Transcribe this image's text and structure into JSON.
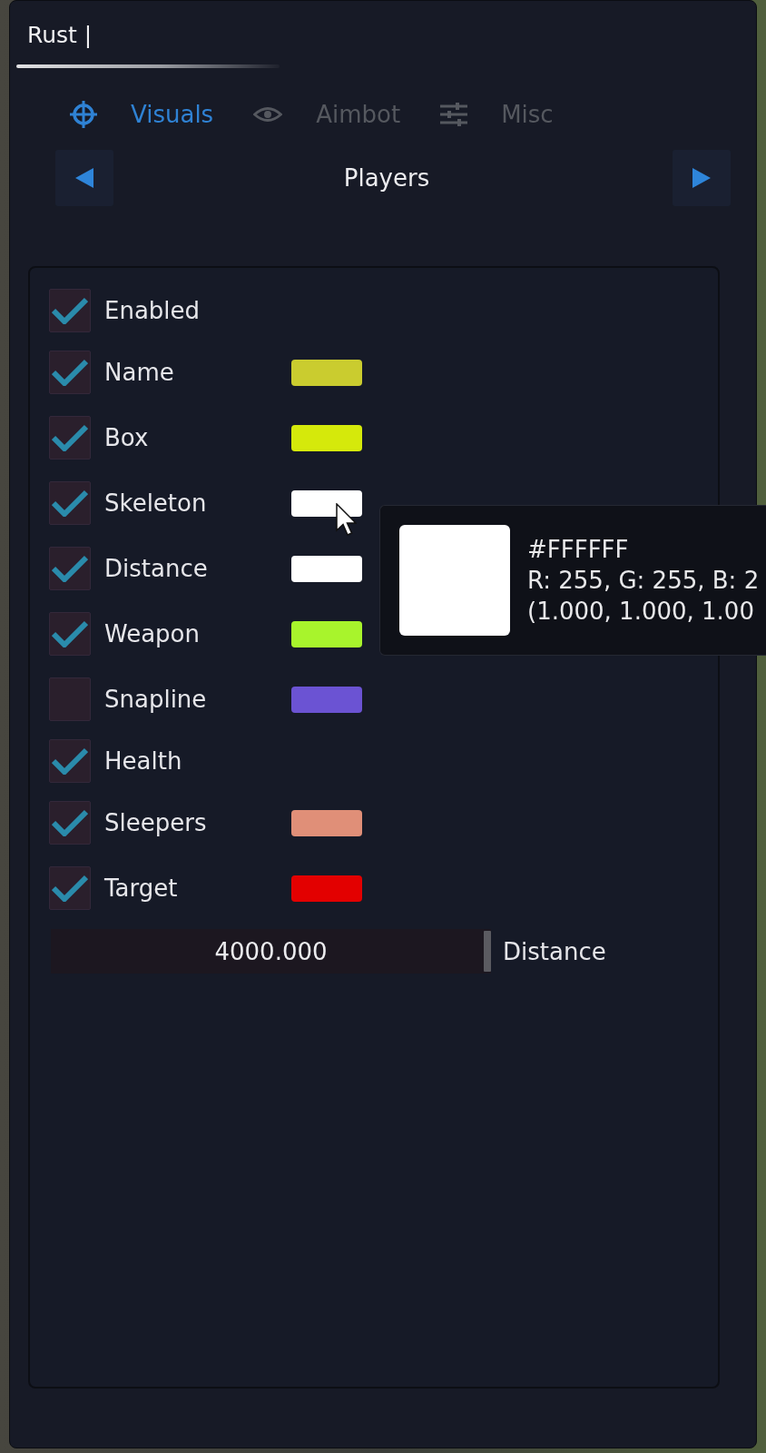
{
  "window": {
    "title": "Rust |"
  },
  "tabs": [
    {
      "label": "Visuals",
      "selected": true
    },
    {
      "label": "Aimbot",
      "selected": false
    },
    {
      "label": "Misc",
      "selected": false
    }
  ],
  "category_nav": {
    "label": "Players"
  },
  "options": [
    {
      "label": "Enabled",
      "checked": true
    },
    {
      "label": "Name",
      "checked": true,
      "color": "#cacc2f"
    },
    {
      "label": "Box",
      "checked": true,
      "color": "#d5e90b"
    },
    {
      "label": "Skeleton",
      "checked": true,
      "color": "#ffffff"
    },
    {
      "label": "Distance",
      "checked": true,
      "color": "#ffffff"
    },
    {
      "label": "Weapon",
      "checked": true,
      "color": "#a8f42c"
    },
    {
      "label": "Snapline",
      "checked": false,
      "color": "#6b53d3"
    },
    {
      "label": "Health",
      "checked": true
    },
    {
      "label": "Sleepers",
      "checked": true,
      "color": "#e08f78"
    },
    {
      "label": "Target",
      "checked": true,
      "color": "#e30000"
    }
  ],
  "distance_slider": {
    "value": "4000.000",
    "label": "Distance",
    "level": 1
  },
  "color_tooltip": {
    "color": "#ffffff",
    "hex": "#FFFFFF",
    "rgb": "R: 255, G: 255, B: 2",
    "normalized": "(1.000, 1.000, 1.00"
  }
}
